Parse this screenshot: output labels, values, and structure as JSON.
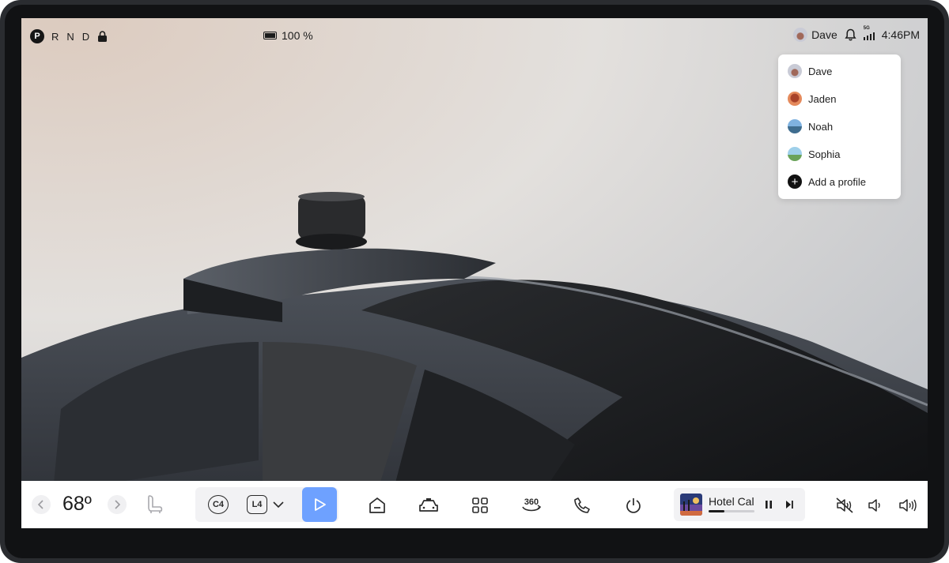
{
  "status_bar": {
    "gears": [
      "P",
      "R",
      "N",
      "D"
    ],
    "active_gear": "P",
    "battery_text": "100 %",
    "user_name": "Dave",
    "time": "4:46PM",
    "signal_label": "5G"
  },
  "profile_menu": {
    "profiles": [
      {
        "name": "Dave"
      },
      {
        "name": "Jaden"
      },
      {
        "name": "Noah"
      },
      {
        "name": "Sophia"
      }
    ],
    "add_label": "Add a profile"
  },
  "bottom_bar": {
    "temperature": "68º",
    "climate_zone": "C4",
    "light_level": "L4",
    "now_playing": {
      "title": "Hotel California",
      "progress": 0.35
    }
  },
  "colors": {
    "accent": "#6ea1ff",
    "bar_bg": "#ffffff",
    "panel_bg": "#f2f2f4"
  }
}
